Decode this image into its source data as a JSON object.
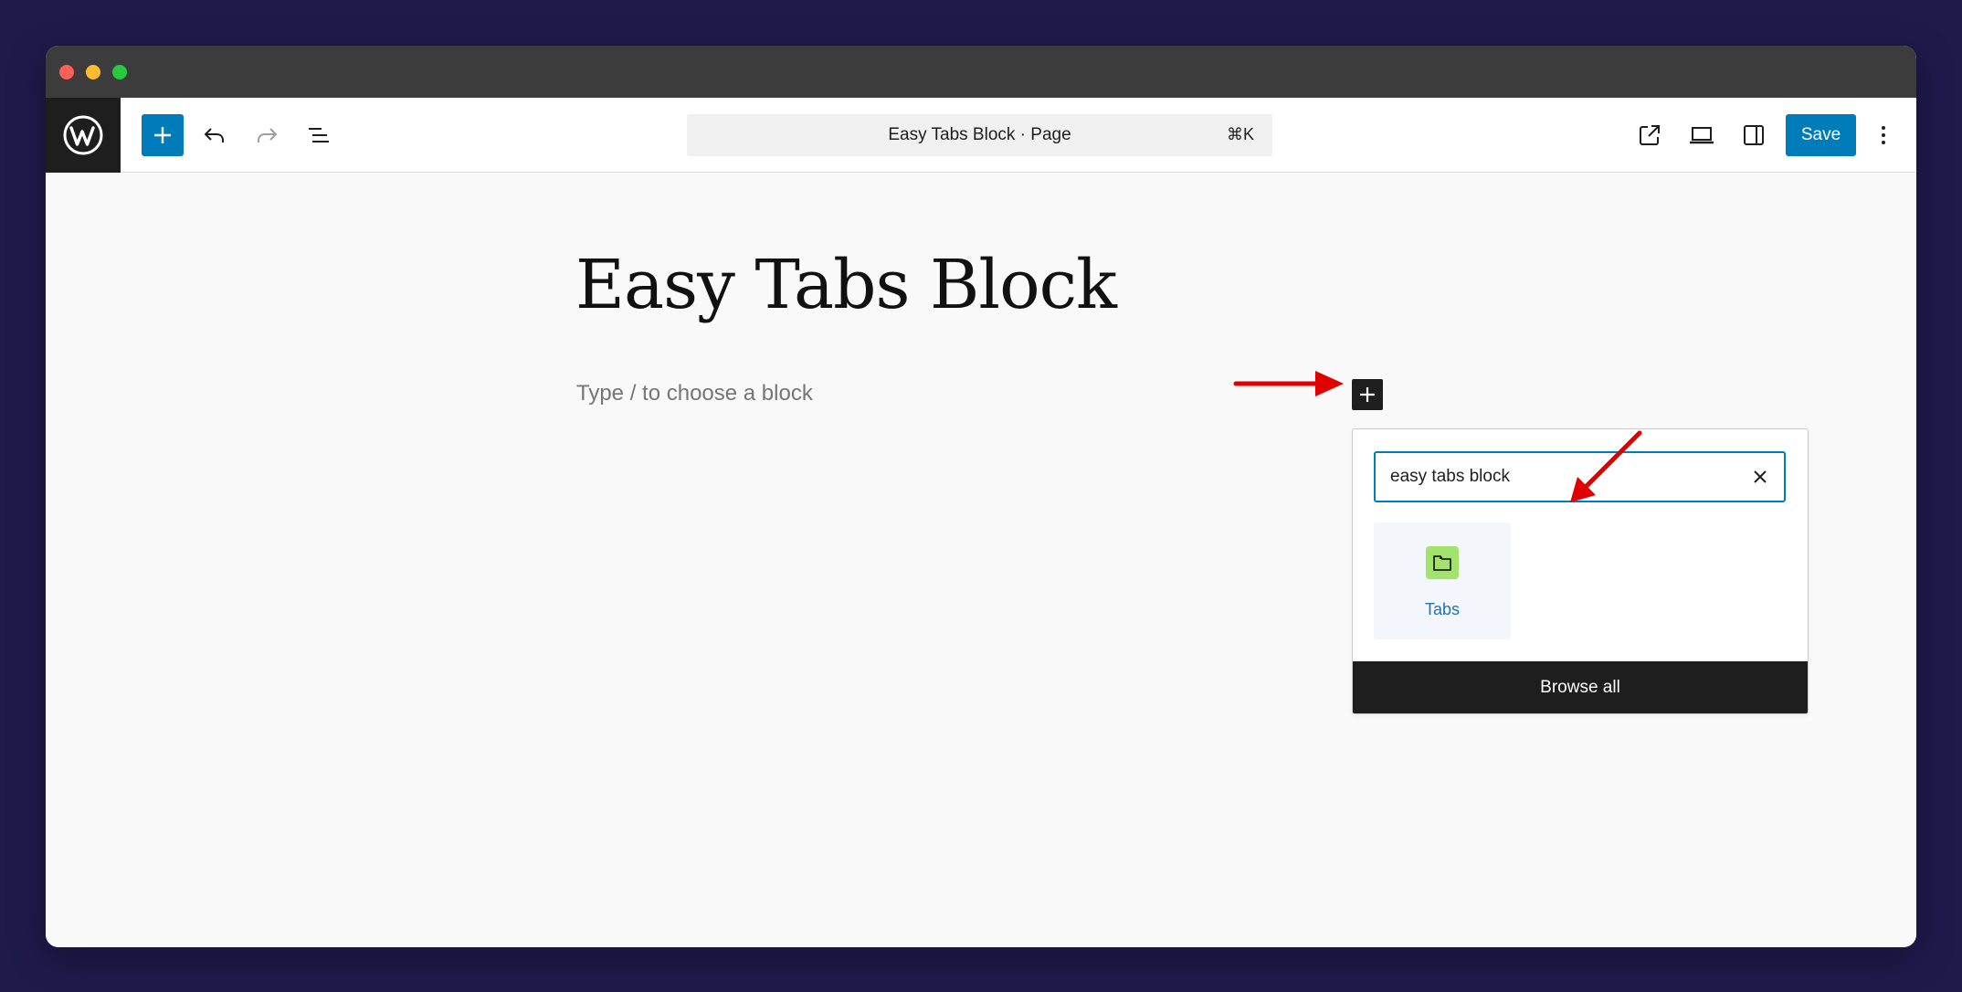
{
  "toolbar": {
    "inserter_icon": "plus-icon",
    "undo_icon": "undo-icon",
    "redo_icon": "redo-icon",
    "list_view_icon": "list-view-icon",
    "command_bar": {
      "title": "Easy Tabs Block · Page",
      "shortcut": "⌘K"
    },
    "view_icon": "external-link-icon",
    "device_icon": "desktop-icon",
    "settings_icon": "sidebar-icon",
    "save_label": "Save",
    "more_icon": "more-vertical-icon"
  },
  "editor": {
    "title": "Easy Tabs Block",
    "placeholder": "Type / to choose a block"
  },
  "inserter_popover": {
    "search_value": "easy tabs block",
    "results": [
      {
        "label": "Tabs",
        "icon": "folder-icon"
      }
    ],
    "browse_all_label": "Browse all"
  },
  "colors": {
    "accent": "#007cba",
    "dark": "#1e1e1e",
    "annotation_arrow": "#e00000",
    "tabs_icon_bg": "#a4e36b"
  }
}
